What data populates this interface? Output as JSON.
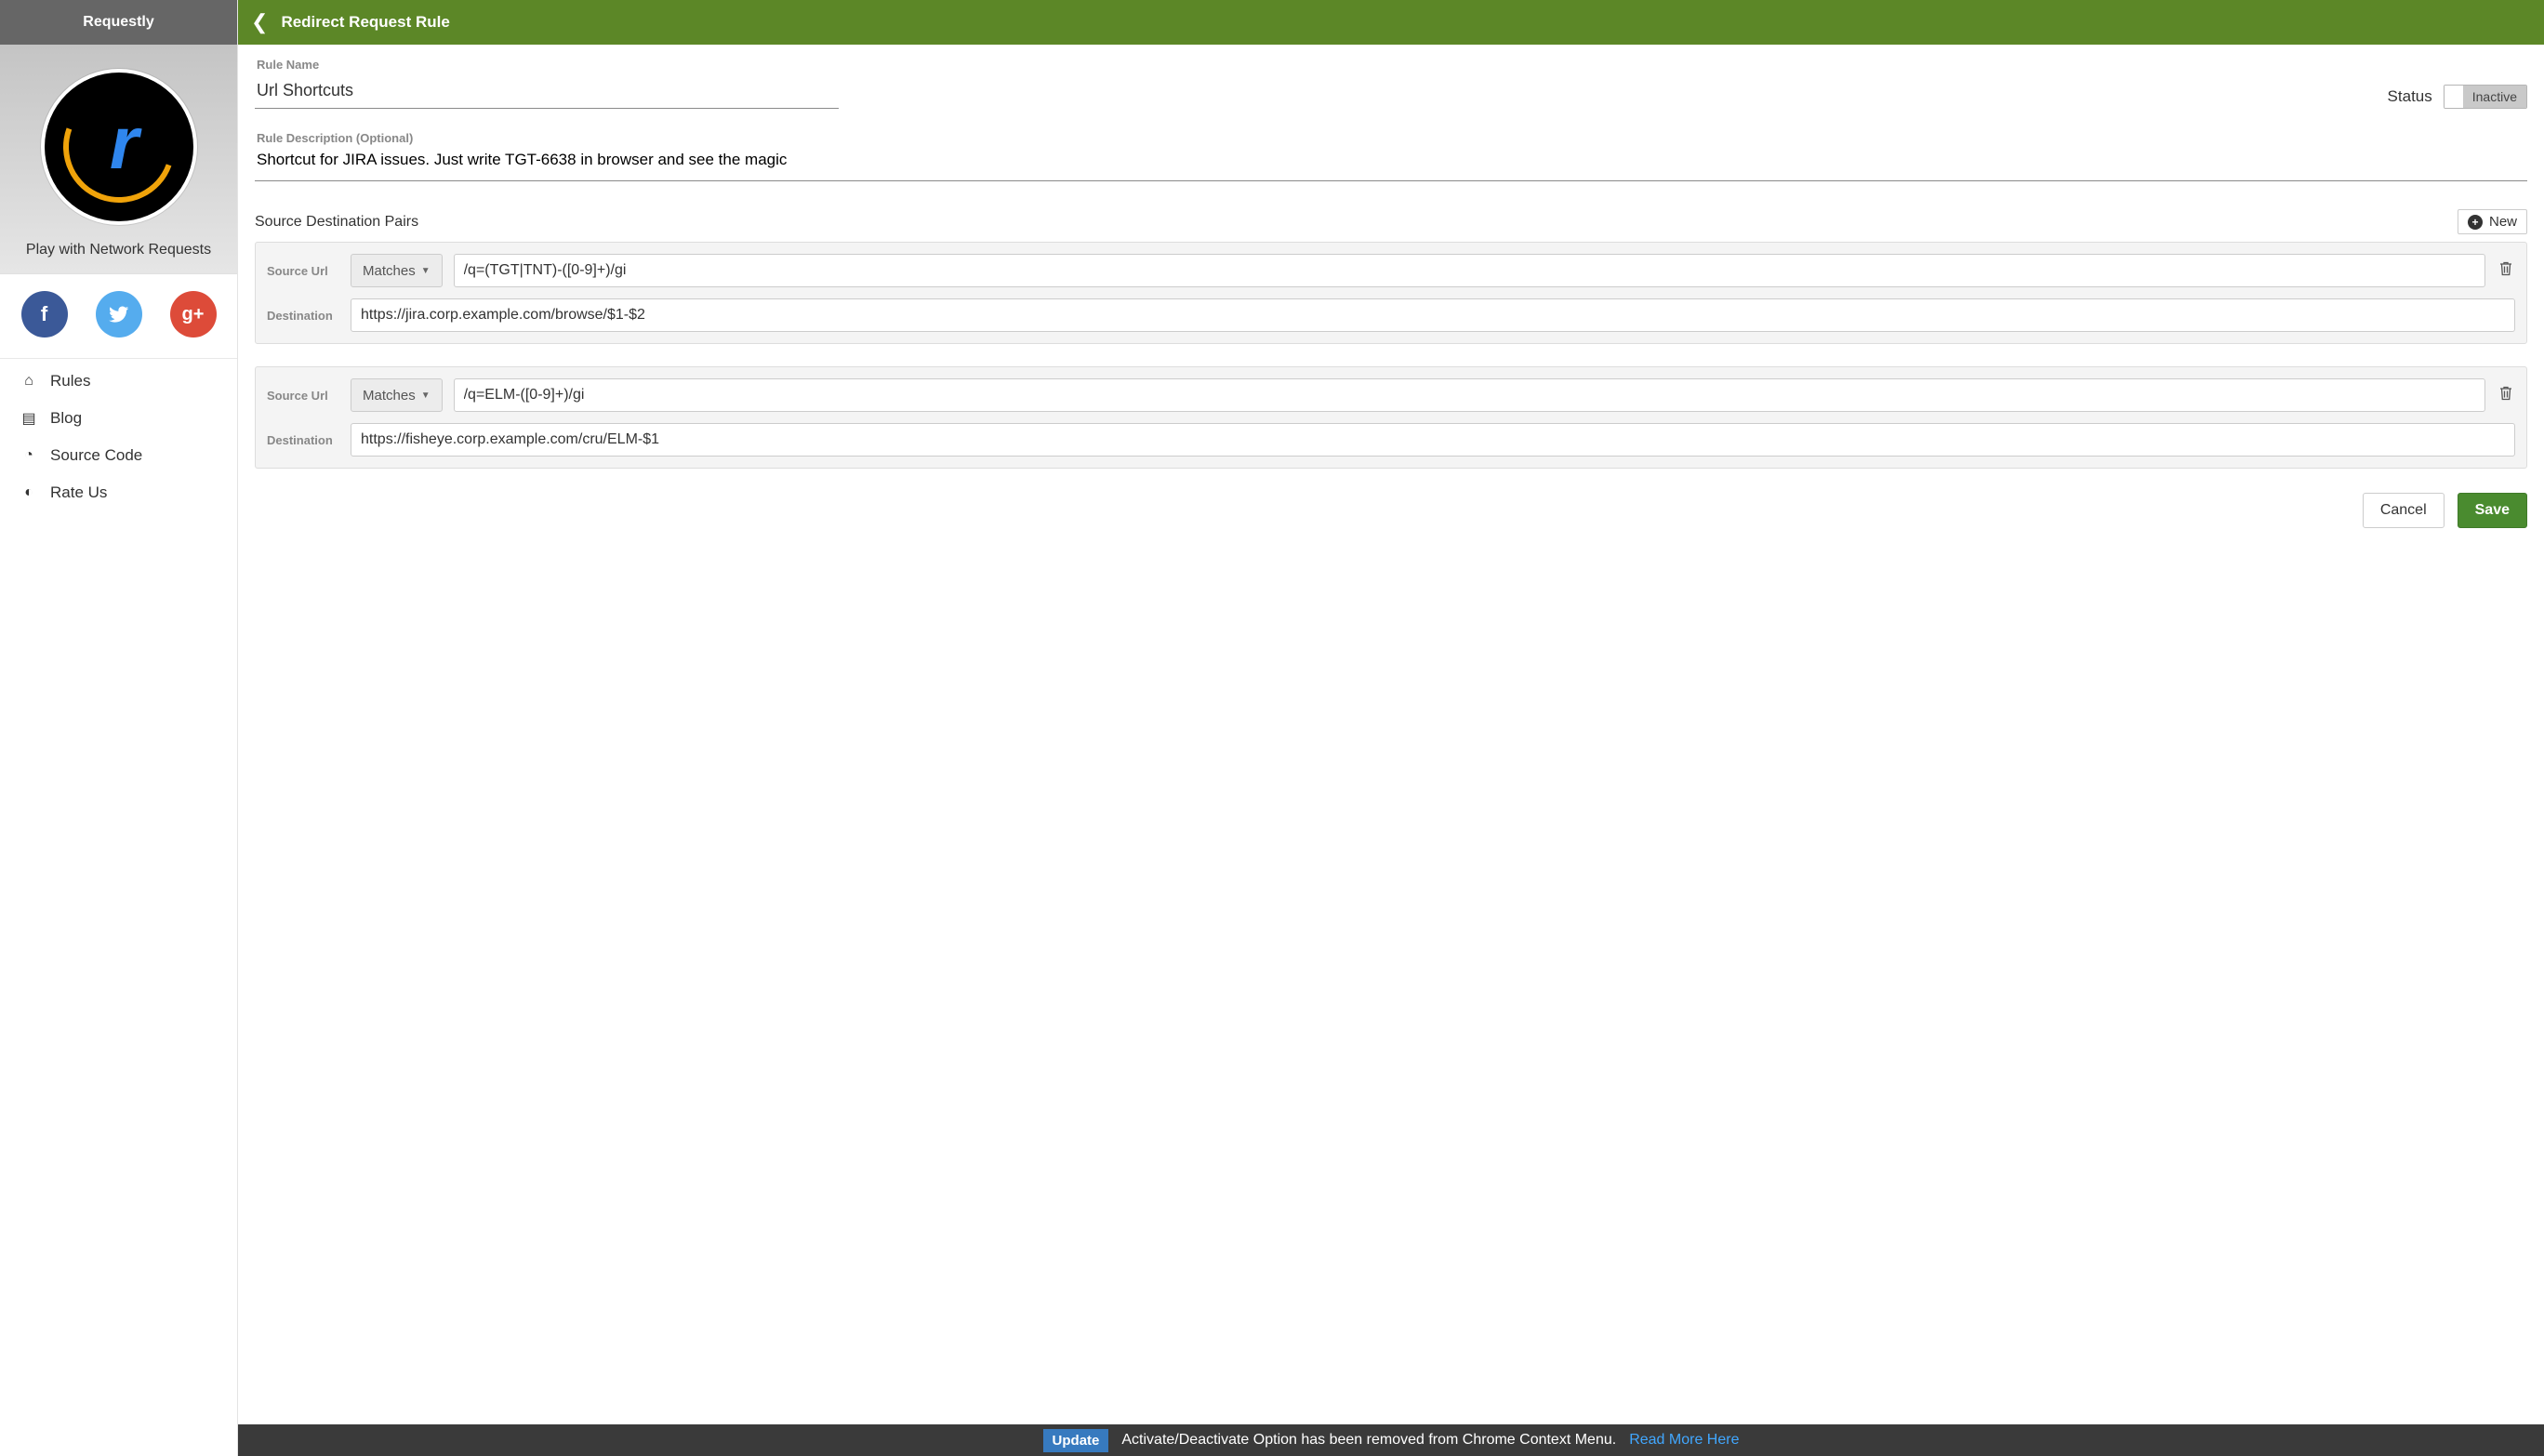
{
  "sidebar": {
    "brand": "Requestly",
    "tagline": "Play with Network Requests",
    "social": {
      "fb": "f",
      "tw": "t",
      "gp": "g+"
    },
    "nav": [
      {
        "icon": "⌂",
        "label": "Rules"
      },
      {
        "icon": "▤",
        "label": "Blog"
      },
      {
        "icon": "◔",
        "label": "Source Code"
      },
      {
        "icon": "◐",
        "label": "Rate Us"
      }
    ]
  },
  "header": {
    "title": "Redirect Request Rule"
  },
  "rule": {
    "name_label": "Rule Name",
    "name_value": "Url Shortcuts",
    "status_label": "Status",
    "status_value": "Inactive",
    "desc_label": "Rule Description (Optional)",
    "desc_value": "Shortcut for JIRA issues. Just write TGT-6638 in browser and see the magic"
  },
  "pairs": {
    "title": "Source Destination Pairs",
    "new_label": "New",
    "source_label": "Source Url",
    "dest_label": "Destination",
    "matches_label": "Matches",
    "items": [
      {
        "source": "/q=(TGT|TNT)-([0-9]+)/gi",
        "destination": "https://jira.corp.example.com/browse/$1-$2"
      },
      {
        "source": "/q=ELM-([0-9]+)/gi",
        "destination": "https://fisheye.corp.example.com/cru/ELM-$1"
      }
    ]
  },
  "actions": {
    "cancel": "Cancel",
    "save": "Save"
  },
  "footer": {
    "badge": "Update",
    "text": "Activate/Deactivate Option has been removed from Chrome Context Menu.",
    "link": "Read More Here"
  }
}
